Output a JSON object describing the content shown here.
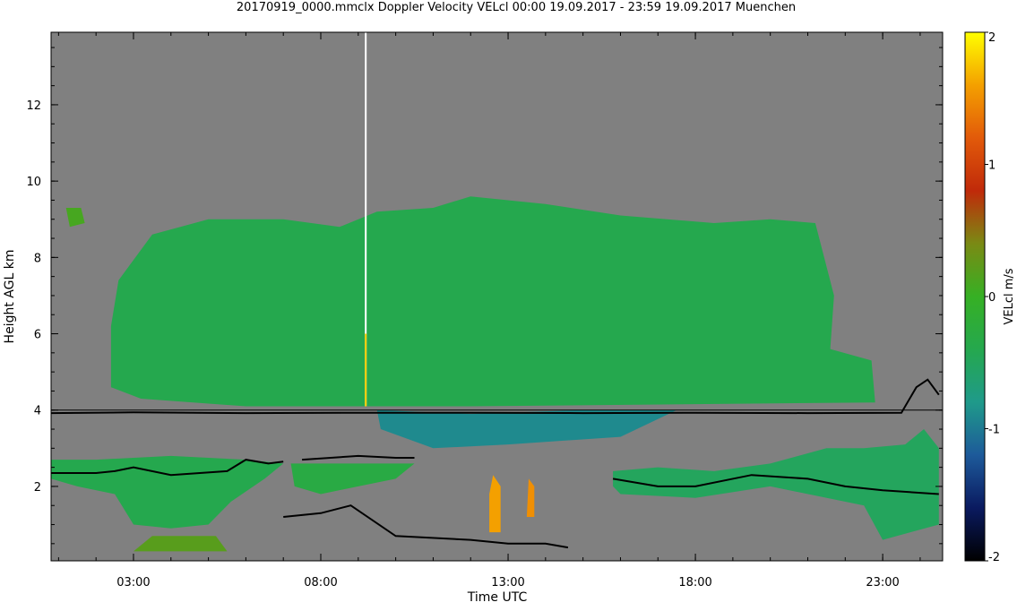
{
  "chart_data": {
    "type": "heatmap",
    "title": "20170919_0000.mmclx Doppler Velocity VELcl   00:00 19.09.2017 - 23:59 19.09.2017 Muenchen",
    "xlabel": "Time UTC",
    "ylabel": "Height AGL km",
    "colorbar_label": "VELcl m/s",
    "x_range_hours": [
      0.8,
      24.6
    ],
    "y_range_km": [
      0.05,
      13.9
    ],
    "x_ticks": [
      {
        "hour": 3,
        "label": "03:00"
      },
      {
        "hour": 8,
        "label": "08:00"
      },
      {
        "hour": 13,
        "label": "13:00"
      },
      {
        "hour": 18,
        "label": "18:00"
      },
      {
        "hour": 23,
        "label": "23:00"
      }
    ],
    "y_ticks": [
      {
        "km": 2,
        "label": "2"
      },
      {
        "km": 4,
        "label": "4"
      },
      {
        "km": 6,
        "label": "6"
      },
      {
        "km": 8,
        "label": "8"
      },
      {
        "km": 10,
        "label": "10"
      },
      {
        "km": 12,
        "label": "12"
      }
    ],
    "colorbar_range": [
      -2,
      2
    ],
    "colorbar_ticks": [
      {
        "value": 2,
        "label": "2"
      },
      {
        "value": 1,
        "label": "1"
      },
      {
        "value": 0,
        "label": "0"
      },
      {
        "value": -1,
        "label": "-1"
      },
      {
        "value": -2,
        "label": "-2"
      }
    ],
    "colormap": [
      "#000000",
      "#0a1a60",
      "#1d5a9a",
      "#1f9a8a",
      "#25a84e",
      "#36b024",
      "#7a8a14",
      "#c02a0a",
      "#e25a0a",
      "#f4a000",
      "#ffff00"
    ],
    "background_color": "#808080",
    "reference_line_km": 4.0,
    "regions": [
      {
        "name": "upper-cloud",
        "vel": -0.4,
        "points": [
          [
            2.4,
            6.2
          ],
          [
            2.6,
            7.4
          ],
          [
            3.5,
            8.6
          ],
          [
            5.0,
            9.0
          ],
          [
            7.0,
            9.0
          ],
          [
            8.5,
            8.8
          ],
          [
            9.5,
            9.2
          ],
          [
            11.0,
            9.3
          ],
          [
            12.0,
            9.6
          ],
          [
            14.0,
            9.4
          ],
          [
            16.0,
            9.1
          ],
          [
            18.5,
            8.9
          ],
          [
            20.0,
            9.0
          ],
          [
            21.2,
            8.9
          ],
          [
            21.7,
            7.0
          ],
          [
            21.6,
            5.6
          ],
          [
            22.7,
            5.3
          ],
          [
            22.8,
            4.2
          ],
          [
            12.0,
            4.1
          ],
          [
            6.0,
            4.1
          ],
          [
            3.2,
            4.3
          ],
          [
            2.4,
            4.6
          ]
        ]
      },
      {
        "name": "lower-cloud-left",
        "vel": -0.4,
        "points": [
          [
            0.8,
            2.7
          ],
          [
            2.0,
            2.7
          ],
          [
            4.0,
            2.8
          ],
          [
            6.0,
            2.7
          ],
          [
            7.0,
            2.6
          ],
          [
            6.5,
            2.2
          ],
          [
            5.6,
            1.6
          ],
          [
            5.0,
            1.0
          ],
          [
            4.0,
            0.9
          ],
          [
            3.0,
            1.0
          ],
          [
            2.5,
            1.8
          ],
          [
            1.5,
            2.0
          ],
          [
            0.8,
            2.2
          ]
        ]
      },
      {
        "name": "lower-cloud-mid",
        "vel": -0.3,
        "points": [
          [
            7.2,
            2.6
          ],
          [
            9.5,
            2.6
          ],
          [
            10.5,
            2.6
          ],
          [
            10.0,
            2.2
          ],
          [
            9.0,
            2.0
          ],
          [
            8.0,
            1.8
          ],
          [
            7.3,
            2.0
          ]
        ]
      },
      {
        "name": "lower-cloud-right",
        "vel": -0.5,
        "points": [
          [
            15.8,
            2.4
          ],
          [
            17.0,
            2.5
          ],
          [
            18.5,
            2.4
          ],
          [
            20.0,
            2.6
          ],
          [
            21.5,
            3.0
          ],
          [
            22.5,
            3.0
          ],
          [
            23.6,
            3.1
          ],
          [
            24.1,
            3.5
          ],
          [
            24.5,
            3.0
          ],
          [
            24.5,
            1.0
          ],
          [
            23.0,
            0.6
          ],
          [
            22.5,
            1.5
          ],
          [
            20.0,
            2.0
          ],
          [
            18.0,
            1.7
          ],
          [
            16.0,
            1.8
          ],
          [
            15.8,
            2.0
          ]
        ]
      },
      {
        "name": "upper-cloud-fall-streaks",
        "vel": -0.9,
        "points": [
          [
            9.5,
            4.0
          ],
          [
            12.0,
            3.9
          ],
          [
            15.0,
            4.0
          ],
          [
            17.5,
            4.0
          ],
          [
            16.0,
            3.3
          ],
          [
            13.0,
            3.1
          ],
          [
            11.0,
            3.0
          ],
          [
            9.6,
            3.5
          ]
        ]
      },
      {
        "name": "small-cloud-left",
        "vel": 0.1,
        "points": [
          [
            1.2,
            9.3
          ],
          [
            1.6,
            9.3
          ],
          [
            1.7,
            8.9
          ],
          [
            1.3,
            8.8
          ]
        ]
      },
      {
        "name": "rain-cell-1",
        "vel": 1.6,
        "points": [
          [
            12.5,
            0.8
          ],
          [
            12.8,
            0.8
          ],
          [
            12.8,
            2.0
          ],
          [
            12.6,
            2.3
          ],
          [
            12.5,
            1.8
          ]
        ]
      },
      {
        "name": "rain-cell-2",
        "vel": 1.5,
        "points": [
          [
            13.5,
            1.2
          ],
          [
            13.7,
            1.2
          ],
          [
            13.7,
            2.0
          ],
          [
            13.55,
            2.2
          ]
        ]
      },
      {
        "name": "surface-echo",
        "vel": 0.2,
        "points": [
          [
            3.0,
            0.3
          ],
          [
            5.5,
            0.3
          ],
          [
            5.2,
            0.7
          ],
          [
            3.5,
            0.7
          ]
        ]
      }
    ],
    "lines": [
      {
        "name": "cloud-top-4km",
        "points": [
          [
            0.8,
            3.92
          ],
          [
            3.0,
            3.94
          ],
          [
            6.0,
            3.92
          ],
          [
            9.2,
            3.93
          ],
          [
            12.0,
            3.93
          ],
          [
            15.0,
            3.92
          ],
          [
            18.0,
            3.93
          ],
          [
            21.0,
            3.92
          ],
          [
            23.5,
            3.93
          ],
          [
            23.9,
            4.6
          ],
          [
            24.2,
            4.8
          ],
          [
            24.5,
            4.4
          ]
        ]
      },
      {
        "name": "cloud-base-left",
        "points": [
          [
            0.8,
            2.35
          ],
          [
            2.0,
            2.35
          ],
          [
            2.5,
            2.4
          ],
          [
            3.0,
            2.5
          ],
          [
            4.0,
            2.3
          ],
          [
            5.5,
            2.4
          ],
          [
            6.0,
            2.7
          ],
          [
            6.6,
            2.6
          ],
          [
            7.0,
            2.65
          ]
        ]
      },
      {
        "name": "cloud-base-mid",
        "points": [
          [
            7.5,
            2.7
          ],
          [
            9.0,
            2.8
          ],
          [
            10.0,
            2.75
          ],
          [
            10.5,
            2.75
          ]
        ]
      },
      {
        "name": "cloud-base-right",
        "points": [
          [
            15.8,
            2.2
          ],
          [
            17.0,
            2.0
          ],
          [
            18.0,
            2.0
          ],
          [
            19.5,
            2.3
          ],
          [
            21.0,
            2.2
          ],
          [
            22.0,
            2.0
          ],
          [
            23.0,
            1.9
          ],
          [
            24.5,
            1.8
          ]
        ]
      },
      {
        "name": "low-level-echo",
        "points": [
          [
            7.0,
            1.2
          ],
          [
            8.0,
            1.3
          ],
          [
            8.8,
            1.5
          ],
          [
            10.0,
            0.7
          ],
          [
            12.0,
            0.6
          ],
          [
            13.0,
            0.5
          ],
          [
            14.0,
            0.5
          ],
          [
            14.6,
            0.4
          ]
        ]
      }
    ],
    "vertical_streak_hour": 9.2
  }
}
